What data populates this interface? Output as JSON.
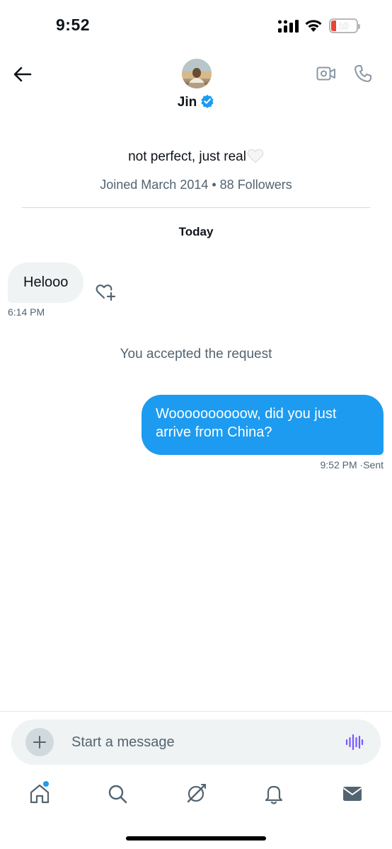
{
  "status_bar": {
    "time": "9:52",
    "battery": "10",
    "icons": [
      "signal-icon",
      "wifi-icon",
      "battery-icon"
    ]
  },
  "header": {
    "name": "Jin",
    "icons": [
      "back-arrow-icon",
      "verified-badge-icon",
      "video-call-icon",
      "phone-icon"
    ],
    "accent": "#1d9bf0"
  },
  "profile": {
    "bio": "not perfect, just real",
    "bio_icon": "white-heart-icon",
    "meta": "Joined March 2014 • 88 Followers"
  },
  "conversation": {
    "date_label": "Today",
    "incoming": {
      "text": "Helooo",
      "time": "6:14 PM",
      "react_icon": "heart-plus-icon"
    },
    "system_note": "You accepted the request",
    "outgoing": {
      "text": "Woooooooooow, did you just arrive from China?",
      "time": "9:52 PM",
      "status": "·Sent"
    }
  },
  "composer": {
    "placeholder": "Start a message",
    "icons": [
      "plus-icon",
      "voice-wave-icon"
    ]
  },
  "tabbar": {
    "items": [
      "home-icon",
      "search-icon",
      "grok-icon",
      "bell-icon",
      "mail-icon"
    ],
    "notification_color": "#1d9bf0"
  }
}
